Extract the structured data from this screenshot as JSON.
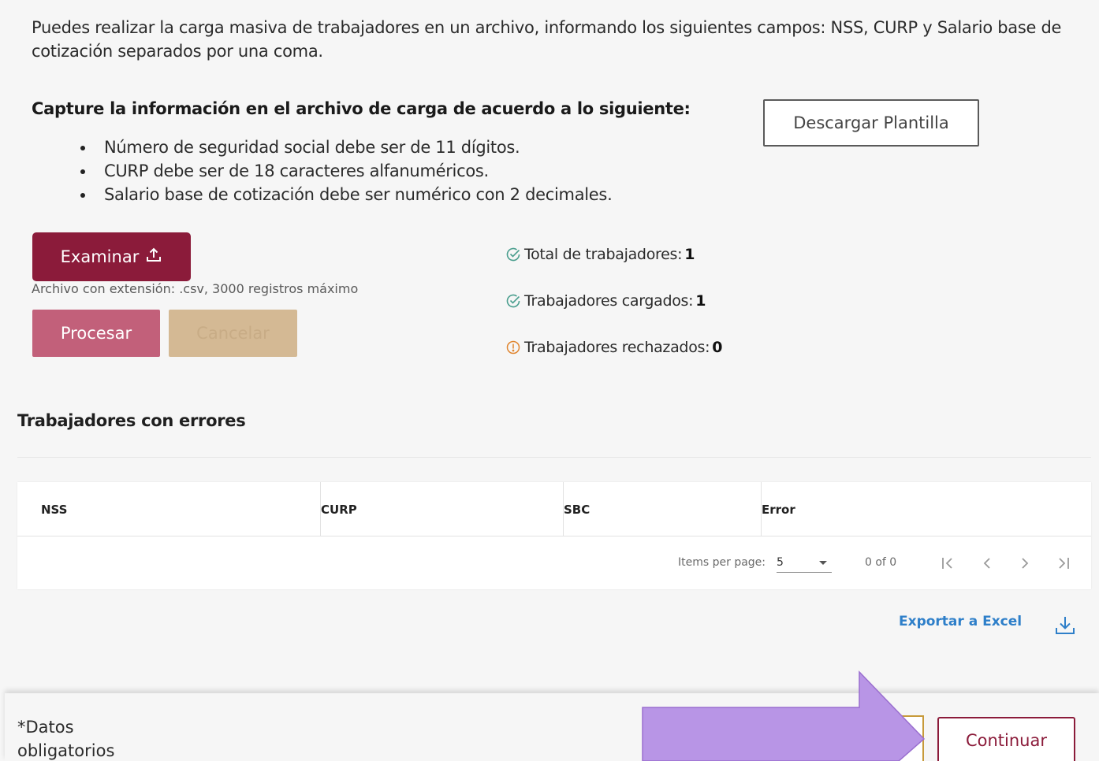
{
  "intro": {
    "text": "Puedes realizar la carga masiva de trabajadores en un archivo, informando los siguientes campos: NSS, CURP y Salario base de cotización separados por una coma."
  },
  "instructions": {
    "title": "Capture la información en el archivo de carga de acuerdo a lo siguiente:",
    "items": [
      "Número de seguridad social debe ser de 11 dígitos.",
      "CURP debe ser de 18 caracteres alfanuméricos.",
      "Salario base de cotización debe ser numérico con 2 decimales."
    ]
  },
  "actions": {
    "download_template_label": "Descargar Plantilla",
    "browse_label": "Examinar",
    "file_hint": "Archivo con extensión: .csv, 3000 registros máximo",
    "process_label": "Procesar",
    "cancel_label": "Cancelar"
  },
  "stats": {
    "total_label": "Total de trabajadores:",
    "total_value": "1",
    "loaded_label": "Trabajadores cargados:",
    "loaded_value": "1",
    "rejected_label": "Trabajadores rechazados:",
    "rejected_value": "0",
    "ok_color": "#4a9e8e",
    "warn_color": "#e0852f"
  },
  "errors_table": {
    "title": "Trabajadores con errores",
    "columns": [
      "NSS",
      "CURP",
      "SBC",
      "Error"
    ],
    "rows": [],
    "paginator": {
      "items_per_page_label": "Items per page:",
      "items_per_page_value": "5",
      "range": "0 of 0"
    }
  },
  "export": {
    "label": "Exportar a Excel",
    "icon": "download-icon",
    "color": "#2e7fc9"
  },
  "footer": {
    "required_note": "*Datos obligatorios",
    "continue_label": "Continuar",
    "accent": "#8b1b3a"
  },
  "overlay": {
    "icon": "pointer-arrow-icon",
    "color": "#b895e6"
  }
}
